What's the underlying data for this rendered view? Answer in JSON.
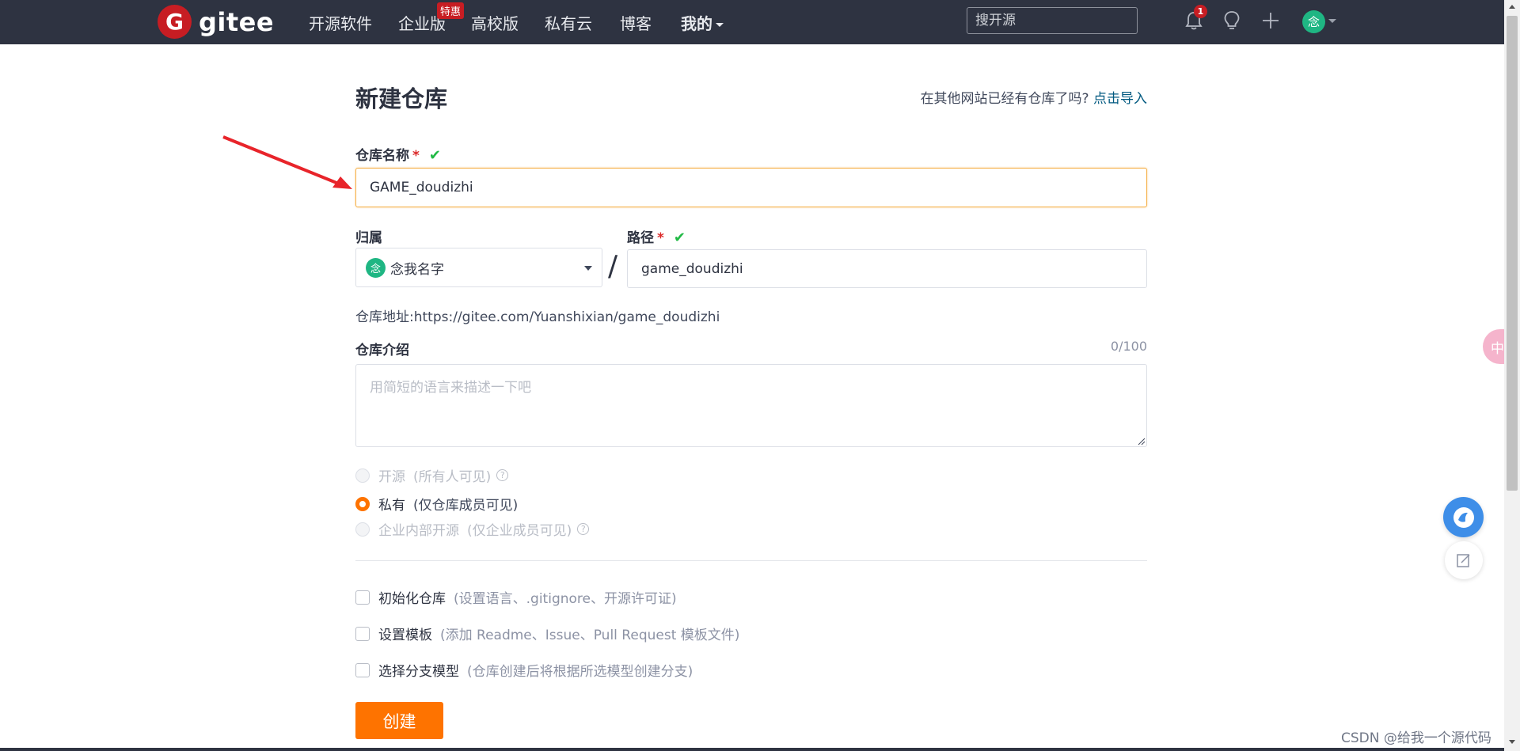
{
  "nav": {
    "logo_letter": "G",
    "logo_text": "gitee",
    "items": [
      "开源软件",
      "企业版",
      "高校版",
      "私有云",
      "博客",
      "我的"
    ],
    "promo_badge": "特惠",
    "search_placeholder": "搜开源",
    "notification_count": "1",
    "avatar_char": "念"
  },
  "form": {
    "title": "新建仓库",
    "import_hint": "在其他网站已经有仓库了吗?",
    "import_link": "点击导入",
    "name_label": "仓库名称",
    "required_mark": "*",
    "name_value": "GAME_doudizhi",
    "owner_label": "归属",
    "owner_avatar_char": "念",
    "owner_value": "念我名字",
    "separator": "/",
    "path_label": "路径",
    "path_value": "game_doudizhi",
    "repo_url_label": "仓库地址:",
    "repo_url_value": "https://gitee.com/Yuanshixian/game_doudizhi",
    "intro_label": "仓库介绍",
    "intro_counter": "0/100",
    "intro_placeholder": "用简短的语言来描述一下吧",
    "visibility": [
      {
        "label": "开源",
        "hint": "(所有人可见)",
        "checked": false,
        "disabled": true,
        "help": true
      },
      {
        "label": "私有",
        "hint": "(仅仓库成员可见)",
        "checked": true,
        "disabled": false,
        "help": false
      },
      {
        "label": "企业内部开源",
        "hint": "(仅企业成员可见)",
        "checked": false,
        "disabled": true,
        "help": true
      }
    ],
    "options": [
      {
        "label": "初始化仓库",
        "hint": "(设置语言、.gitignore、开源许可证)"
      },
      {
        "label": "设置模板",
        "hint": "(添加 Readme、Issue、Pull Request 模板文件)"
      },
      {
        "label": "选择分支模型",
        "hint": "(仓库创建后将根据所选模型创建分支)"
      }
    ],
    "create_button": "创建"
  },
  "floating": {
    "lang_button": "中"
  },
  "watermark": "CSDN @给我一个源代码",
  "colors": {
    "nav_bg": "#2e3341",
    "brand": "#c71d23",
    "accent": "#fe7300",
    "success": "#21ba45",
    "link": "#005980"
  },
  "icons": [
    "bell-icon",
    "lightbulb-icon",
    "plus-icon",
    "check-icon",
    "help-icon",
    "chat-icon",
    "edit-icon",
    "arrow-annotation"
  ]
}
